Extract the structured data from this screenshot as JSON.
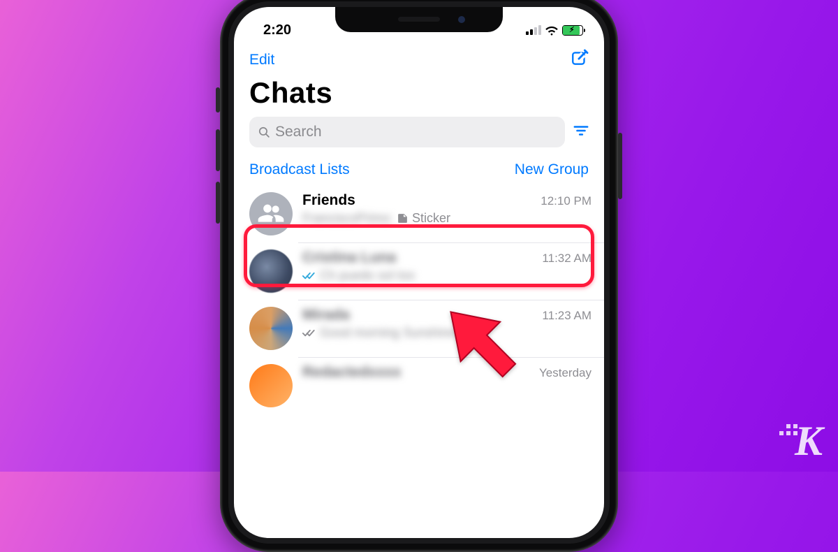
{
  "status": {
    "time": "2:20"
  },
  "nav": {
    "edit": "Edit"
  },
  "title": "Chats",
  "search": {
    "placeholder": "Search"
  },
  "links": {
    "broadcast": "Broadcast Lists",
    "new_group": "New Group"
  },
  "chats": [
    {
      "name": "Friends",
      "time": "12:10 PM",
      "preview_label": "Sticker"
    },
    {
      "name": "Cristina Luna",
      "time": "11:32 AM",
      "preview": "Ch puedo sol too"
    },
    {
      "name": "Mirada",
      "time": "11:23 AM",
      "preview": "Good morning Sunshine ☀️"
    },
    {
      "name": "(blurred)",
      "time": "Yesterday"
    }
  ],
  "watermark": "K"
}
